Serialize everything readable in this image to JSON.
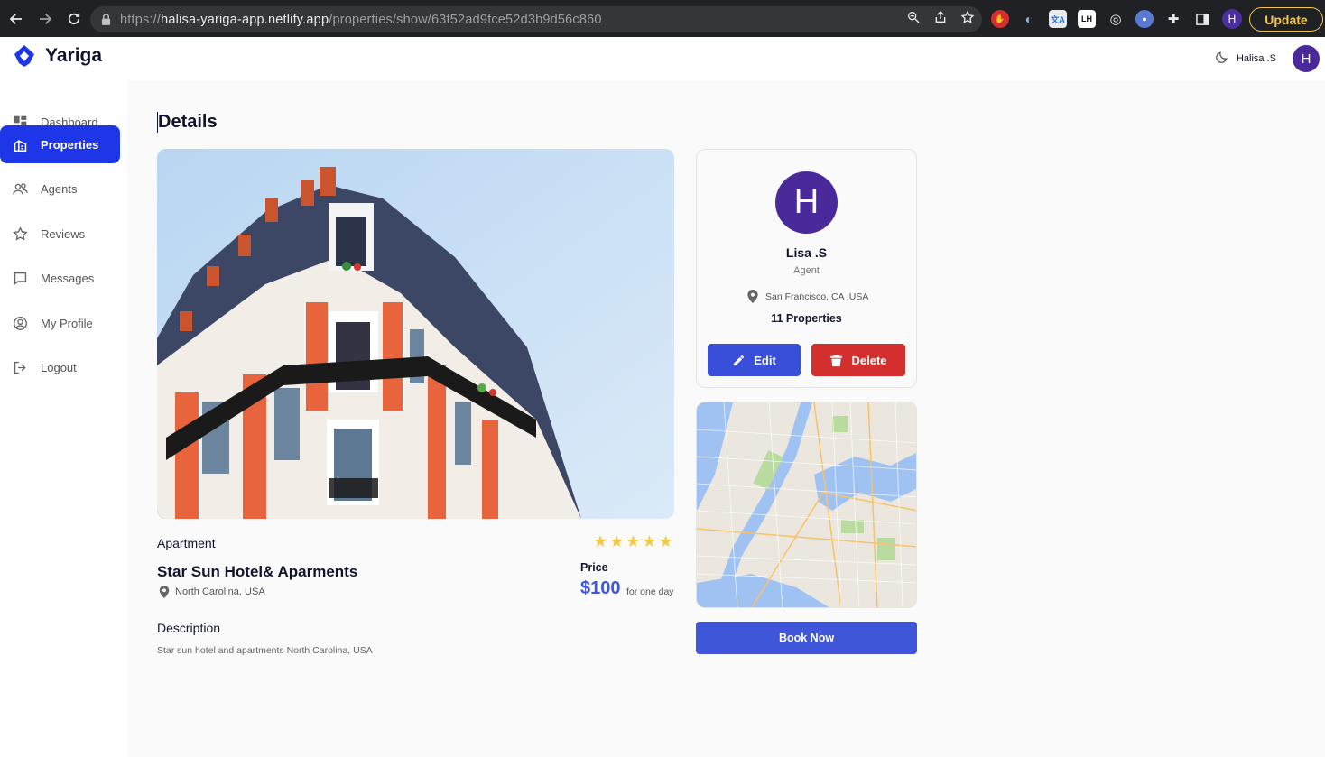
{
  "browser": {
    "url_scheme": "https://",
    "url_host": "halisa-yariga-app.netlify.app",
    "url_path": "/properties/show/63f52ad9fce52d3b9d56c860",
    "profile_initial": "H",
    "update_label": "Update",
    "accent": "#f2c94c"
  },
  "app": {
    "logo_text": "Yariga",
    "brand_color": "#1e36e8"
  },
  "sidebar": {
    "items": [
      {
        "label": "Dashboard",
        "icon": "dashboard-icon",
        "active": false
      },
      {
        "label": "Properties",
        "icon": "properties-icon",
        "active": true
      },
      {
        "label": "Agents",
        "icon": "agents-icon",
        "active": false
      },
      {
        "label": "Reviews",
        "icon": "star-icon",
        "active": false
      },
      {
        "label": "Messages",
        "icon": "message-icon",
        "active": false
      },
      {
        "label": "My Profile",
        "icon": "profile-icon",
        "active": false
      },
      {
        "label": "Logout",
        "icon": "logout-icon",
        "active": false
      }
    ]
  },
  "header": {
    "user_name": "Halisa .S",
    "user_initial": "H"
  },
  "page": {
    "title": "Details"
  },
  "property": {
    "type": "Apartment",
    "rating": 5,
    "title": "Star Sun Hotel& Aparments",
    "location": "North Carolina, USA",
    "price_label": "Price",
    "price": "$100",
    "price_period": "for one day",
    "description_label": "Description",
    "description": "Star sun hotel and apartments North Carolina, USA"
  },
  "agent": {
    "initial": "H",
    "name": "Lisa .S",
    "role": "Agent",
    "location": "San Francisco, CA ,USA",
    "properties": "11 Properties",
    "edit_label": "Edit",
    "delete_label": "Delete"
  },
  "actions": {
    "book_label": "Book Now"
  }
}
